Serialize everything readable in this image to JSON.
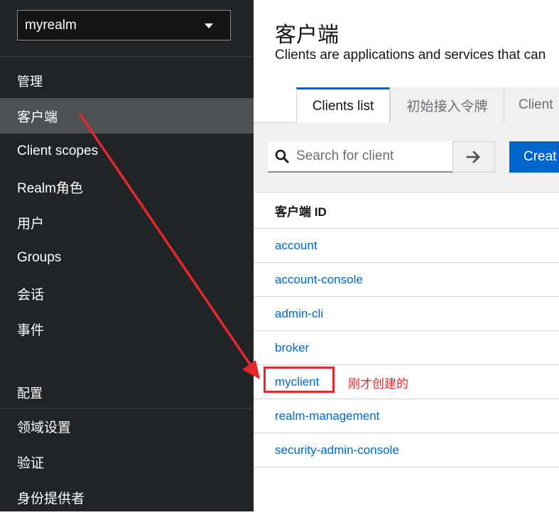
{
  "sidebar": {
    "realm_select": {
      "value": "myrealm"
    },
    "manage_section": "管理",
    "manage_items": [
      {
        "label": "客户端",
        "active": true
      },
      {
        "label": "Client scopes"
      },
      {
        "label": "Realm角色"
      },
      {
        "label": "用户"
      },
      {
        "label": "Groups"
      },
      {
        "label": "会话"
      },
      {
        "label": "事件"
      }
    ],
    "configure_section": "配置",
    "configure_items": [
      {
        "label": "领域设置"
      },
      {
        "label": "验证"
      },
      {
        "label": "身份提供者"
      }
    ]
  },
  "main": {
    "title": "客户端",
    "description": "Clients are applications and services that can",
    "tabs": [
      {
        "label": "Clients list",
        "active": true
      },
      {
        "label": "初始接入令牌"
      },
      {
        "label": "Client"
      }
    ],
    "search": {
      "placeholder": "Search for client"
    },
    "create_button": "Creat",
    "table": {
      "header": "客户端 ID",
      "rows": [
        "account",
        "account-console",
        "admin-cli",
        "broker",
        "myclient",
        "realm-management",
        "security-admin-console"
      ]
    }
  },
  "annotation": {
    "note": "刚才创建的",
    "color": "#e8262b"
  },
  "colors": {
    "sidebar_bg": "#212427",
    "active_item_bg": "#4f5255",
    "link": "#0066cc",
    "primary": "#0066cc"
  }
}
